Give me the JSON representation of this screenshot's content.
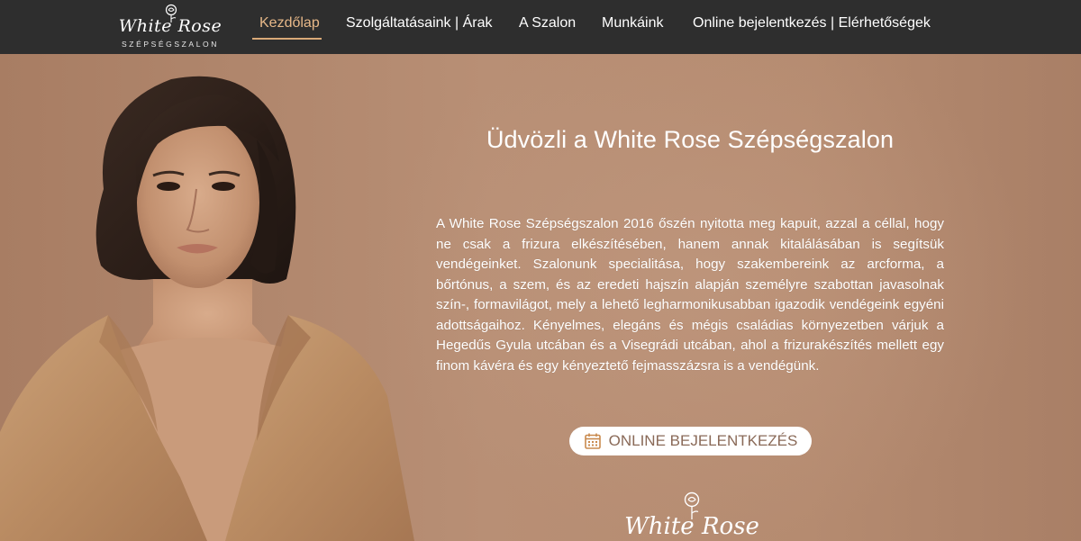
{
  "brand": {
    "logo_script": "White Rose",
    "logo_sub": "SZÉPSÉGSZALON"
  },
  "nav": {
    "items": [
      {
        "label": "Kezdőlap",
        "active": true
      },
      {
        "label": "Szolgáltatásaink | Árak",
        "active": false
      },
      {
        "label": "A Szalon",
        "active": false
      },
      {
        "label": "Munkáink",
        "active": false
      },
      {
        "label": "Online bejelentkezés | Elérhetőségek",
        "active": false
      }
    ]
  },
  "hero": {
    "title": "Üdvözli a White Rose Szépségszalon",
    "paragraph": "A White Rose Szépségszalon 2016 őszén nyitotta meg kapuit, azzal a céllal, hogy ne csak a frizura elkészítésében, hanem annak kitalálásában is segítsük vendégeinket. Szalonunk specialitása, hogy szakembereink az arcforma, a bőrtónus, a szem, és az eredeti hajszín alapján személyre szabottan javasolnak szín-, formavilágot, mely a lehető legharmonikusabban igazodik vendégeink egyéni adottságaihoz. Kényelmes, elegáns és mégis családias környezetben várjuk a Hegedűs Gyula utcában és a Visegrádi utcában, ahol a frizurakészítés mellett egy finom kávéra és egy kényeztető fejmasszázsra is a vendégünk.",
    "button_label": "ONLINE BEJELENTKEZÉS",
    "button_icon": "calendar-icon",
    "footer_logo_script": "White Rose"
  },
  "colors": {
    "navbar_bg": "#2e2e2e",
    "active_nav": "#e7b888",
    "hero_bg": "#b48a70",
    "button_text": "#8a6a58"
  }
}
